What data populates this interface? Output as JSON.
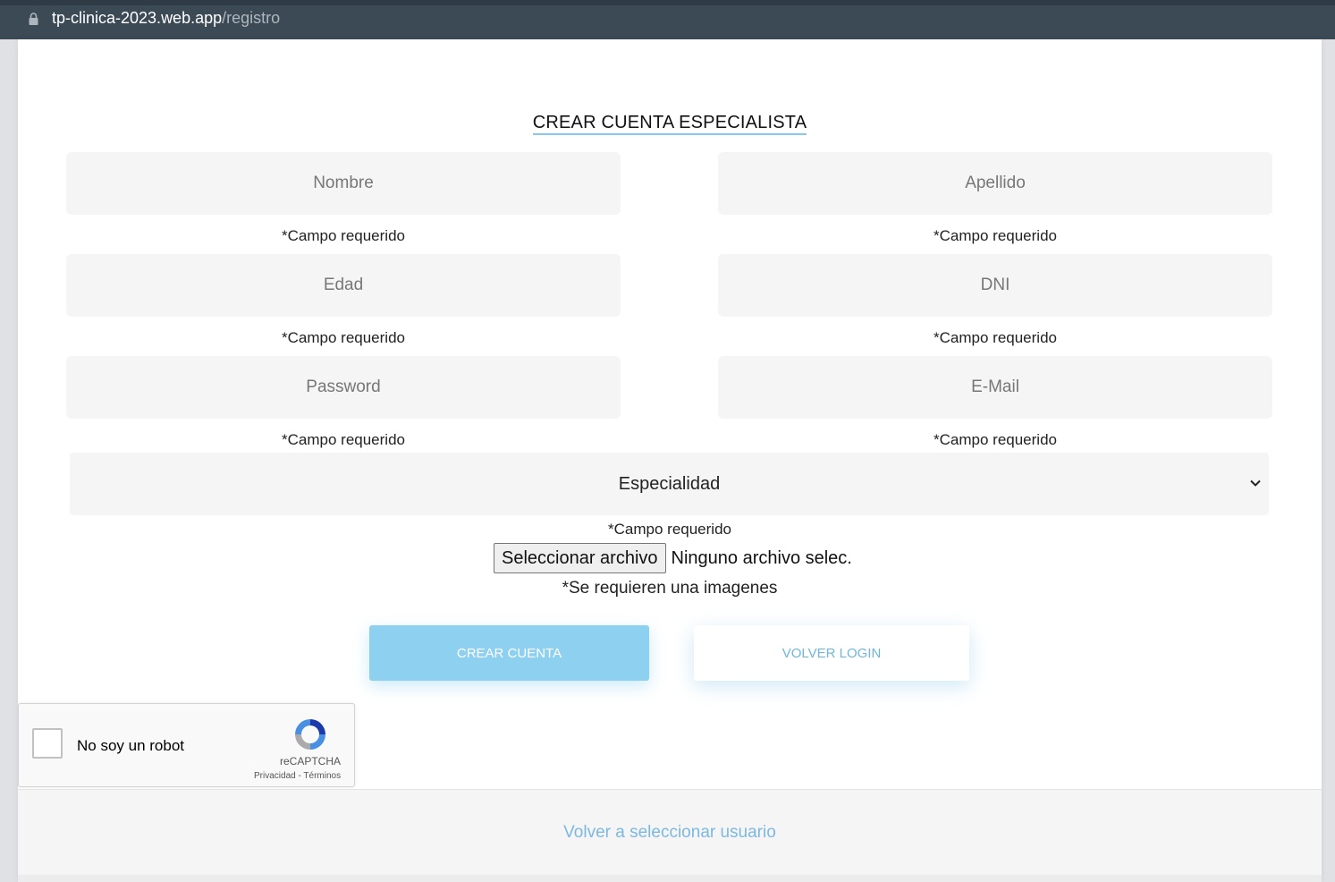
{
  "browser": {
    "url_host": "tp-clinica-2023.web.app",
    "url_path": "/registro"
  },
  "form": {
    "title": "CREAR CUENTA ESPECIALISTA",
    "fields": [
      {
        "placeholder": "Nombre",
        "required_text": "*Campo requerido"
      },
      {
        "placeholder": "Apellido",
        "required_text": "*Campo requerido"
      },
      {
        "placeholder": "Edad",
        "required_text": "*Campo requerido"
      },
      {
        "placeholder": "DNI",
        "required_text": "*Campo requerido"
      },
      {
        "placeholder": "Password",
        "required_text": "*Campo requerido"
      },
      {
        "placeholder": "E-Mail",
        "required_text": "*Campo requerido"
      }
    ],
    "specialty": {
      "selected": "Especialidad",
      "required_text": "*Campo requerido"
    },
    "file": {
      "button_label": "Seleccionar archivo",
      "status": "Ninguno archivo selec.",
      "hint": "*Se requieren una imagenes"
    },
    "create_button": "CREAR CUENTA",
    "back_login_button": "VOLVER LOGIN"
  },
  "captcha": {
    "label": "No soy un robot",
    "brand": "reCAPTCHA",
    "links": "Privacidad - Términos"
  },
  "footer": {
    "link": "Volver a seleccionar usuario"
  },
  "colors": {
    "accent": "#8ed0ef",
    "link": "#7db8e0",
    "field_bg": "#f5f5f5"
  }
}
